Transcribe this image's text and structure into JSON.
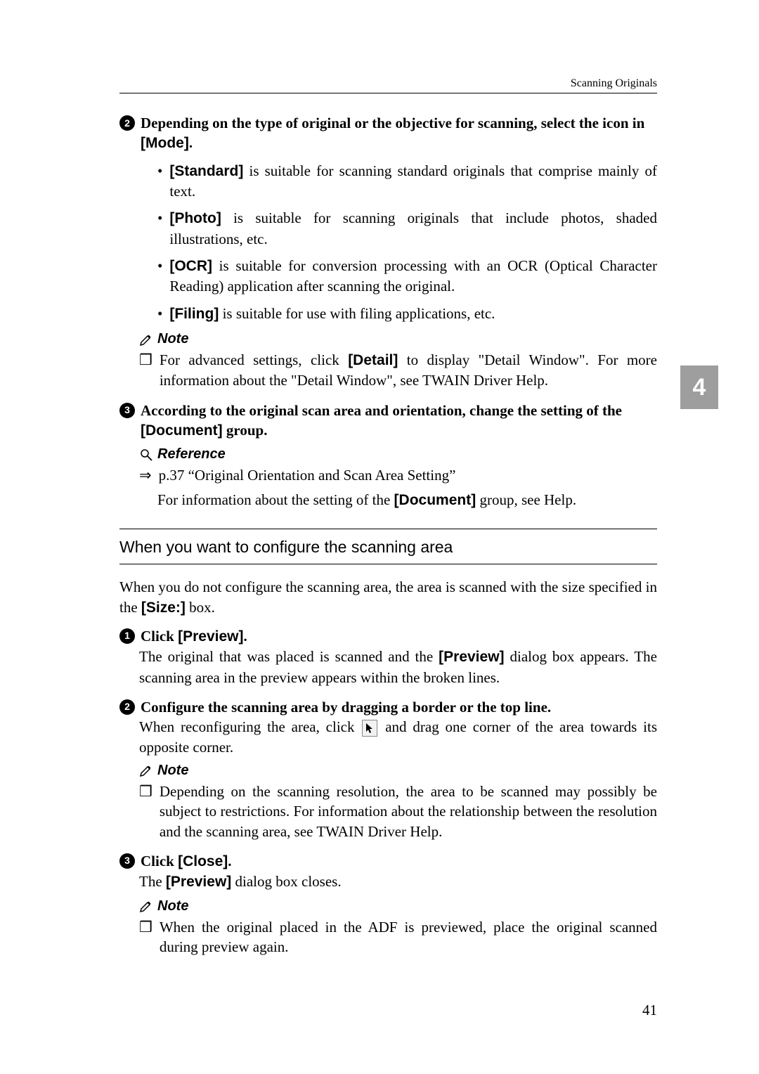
{
  "header": "Scanning Originals",
  "side_tab": "4",
  "step2": {
    "text_a": "Depending on the type of original or the objective for scanning, select the icon in ",
    "mode": "[Mode]",
    "text_b": ".",
    "bullets": [
      {
        "b": "[Standard]",
        "t": " is suitable for scanning standard originals that comprise mainly of text."
      },
      {
        "b": "[Photo]",
        "t": " is suitable for scanning originals that include photos, shaded illustrations, etc."
      },
      {
        "b": "[OCR]",
        "t": " is suitable for conversion processing with an OCR (Optical Character Reading) application after scanning the original."
      },
      {
        "b": "[Filing]",
        "t": " is suitable for use with filing applications, etc."
      }
    ]
  },
  "note_label": "Note",
  "note2": {
    "a": "For advanced settings, click ",
    "b": "[Detail]",
    "c": " to display \"Detail Window\". For more information about the \"Detail Window\", see TWAIN Driver Help."
  },
  "step3": {
    "a": "According to the original scan area and orientation, change the setting of the ",
    "b": "[Document]",
    "c": " group."
  },
  "ref_label": "Reference",
  "ref3a": "p.37 “Original Orientation and Scan Area Setting”",
  "ref3b": {
    "a": "For information about the setting of the ",
    "b": "[Document]",
    "c": " group, see Help."
  },
  "subsection": "When you want to configure the scanning area",
  "intro": {
    "a": "When you do not configure the scanning area, the area is scanned with the size specified in the ",
    "b": "[Size:]",
    "c": " box."
  },
  "s1": {
    "a": "Click ",
    "b": "[Preview]",
    "c": "."
  },
  "s1_body": {
    "a": "The original that was placed is scanned and the ",
    "b": "[Preview]",
    "c": " dialog box appears. The scanning area in the preview appears within the broken lines."
  },
  "s2": "Configure the scanning area by dragging a border or the top line.",
  "s2_body": {
    "a": "When reconfiguring the area, click ",
    "b": " and drag one corner of the area towards its opposite corner."
  },
  "note_s2": "Depending on the scanning resolution, the area to be scanned may possibly be subject to restrictions. For information about the relationship between the resolution and the scanning area, see TWAIN Driver Help.",
  "s3": {
    "a": "Click ",
    "b": "[Close]",
    "c": "."
  },
  "s3_body": {
    "a": "The ",
    "b": "[Preview]",
    "c": " dialog box closes."
  },
  "note_s3": "When the original placed in the ADF is previewed, place the original scanned during preview again.",
  "page_num": "41"
}
